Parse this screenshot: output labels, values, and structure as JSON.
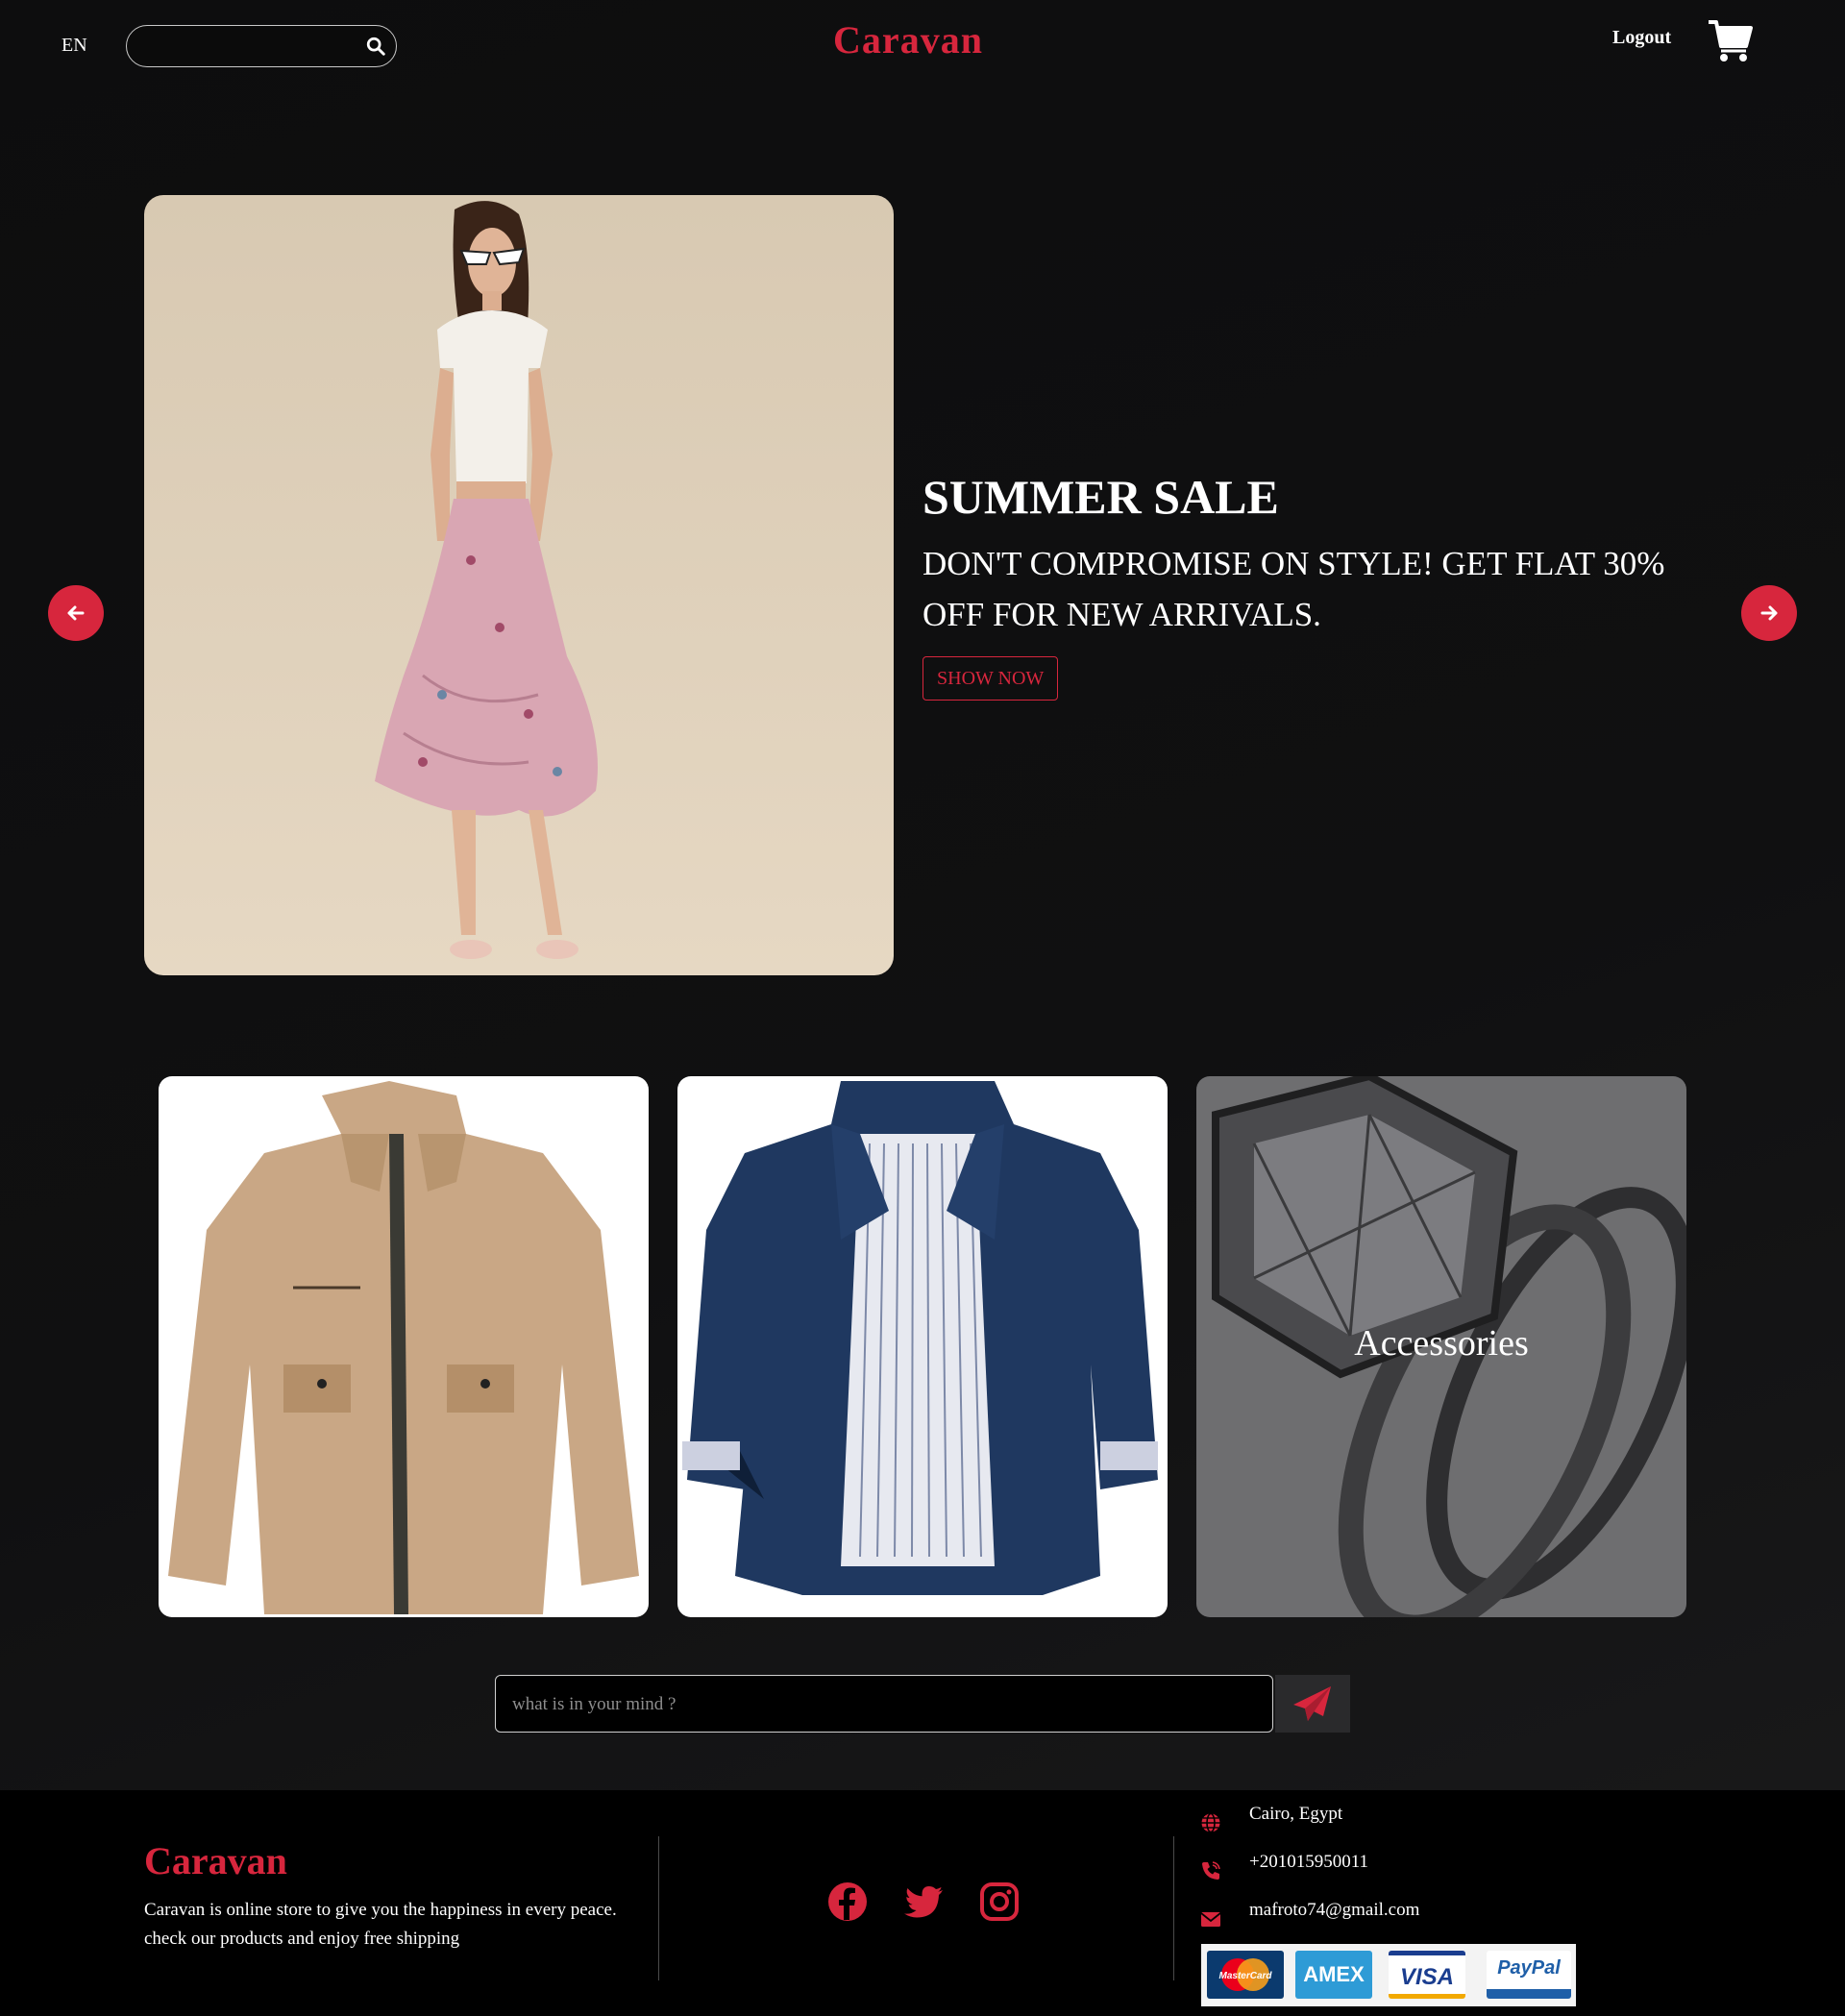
{
  "header": {
    "language": "EN",
    "search": {
      "placeholder": "",
      "value": ""
    },
    "brand": "Caravan",
    "logout_label": "Logout",
    "icons": {
      "search": "search-icon",
      "cart": "shopping-cart-icon"
    }
  },
  "hero": {
    "title": "SUMMER SALE",
    "subtitle": "DON'T COMPROMISE ON STYLE! GET FLAT 30% OFF FOR NEW ARRIVALS.",
    "cta_label": "SHOW NOW",
    "icons": {
      "prev": "arrow-left-icon",
      "next": "arrow-right-icon"
    }
  },
  "categories": [
    {
      "label": ""
    },
    {
      "label": ""
    },
    {
      "label": "Accessories"
    }
  ],
  "message": {
    "placeholder": "what is in your mind ?",
    "value": "",
    "send_icon": "paper-plane-icon"
  },
  "footer": {
    "brand": "Caravan",
    "description": "Caravan is online store to give you the happiness in every peace. check our products and enjoy free shipping",
    "social": [
      "facebook-icon",
      "twitter-icon",
      "instagram-icon"
    ],
    "contact": {
      "address": "Cairo, Egypt",
      "phone": "+201015950011",
      "email": "mafroto74@gmail.com"
    },
    "payments": [
      "MasterCard",
      "AMEX",
      "VISA",
      "PayPal"
    ]
  },
  "colors": {
    "accent": "#d7263d",
    "background": "#0f0f10",
    "footer": "#000000"
  }
}
